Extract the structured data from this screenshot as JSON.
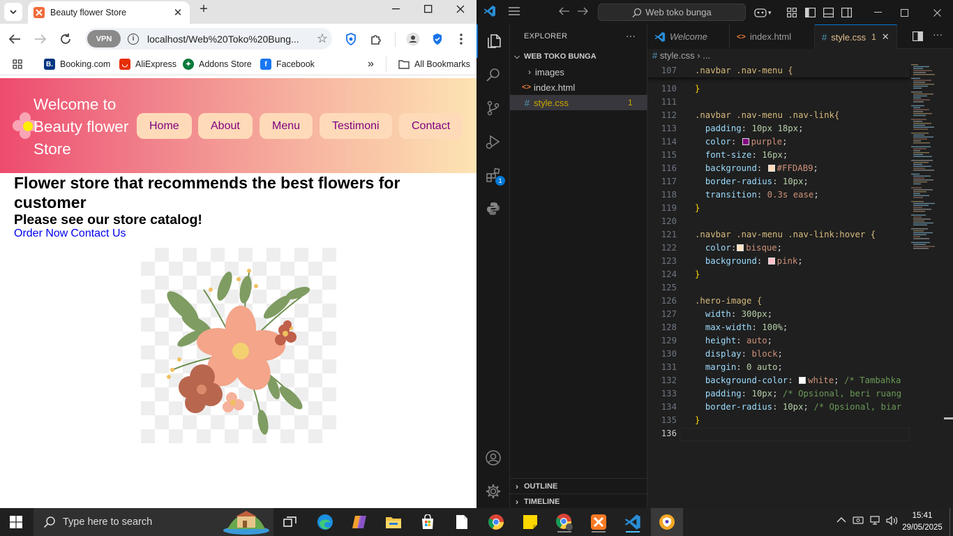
{
  "browser": {
    "tab_title": "Beauty flower Store",
    "url": "localhost/Web%20Toko%20Bung...",
    "vpn_label": "VPN",
    "bookmarks": [
      "Booking.com",
      "AliExpress",
      "Addons Store",
      "Facebook"
    ],
    "bookmarks_overflow": "»",
    "all_bookmarks": "All Bookmarks"
  },
  "page": {
    "brand": "Welcome to Beauty flower Store",
    "nav": [
      "Home",
      "About",
      "Menu",
      "Testimoni",
      "Contact"
    ],
    "heading": "Flower store that recommends the best flowers for customer",
    "subheading": "Please see our store catalog!",
    "link_order": "Order Now",
    "link_contact": "Contact Us"
  },
  "vscode": {
    "search": "Web toko bunga",
    "explorer_title": "EXPLORER",
    "project": "WEB TOKO BUNGA",
    "tree": [
      {
        "name": "images",
        "type": "folder"
      },
      {
        "name": "index.html",
        "type": "html"
      },
      {
        "name": "style.css",
        "type": "css",
        "problems": "1"
      }
    ],
    "sections": [
      "OUTLINE",
      "TIMELINE"
    ],
    "tabs": [
      "Welcome",
      "index.html",
      "style.css"
    ],
    "active_tab_problems": "1",
    "breadcrumb": "style.css  ›  ...",
    "extensions_badge": "1",
    "sticky_line": "107",
    "sticky_code": ".navbar .nav-menu {",
    "line_numbers": [
      "110",
      "111",
      "112",
      "113",
      "114",
      "115",
      "116",
      "117",
      "118",
      "119",
      "120",
      "121",
      "122",
      "123",
      "124",
      "125",
      "126",
      "127",
      "128",
      "129",
      "130",
      "131",
      "132",
      "133",
      "134",
      "135",
      "136"
    ],
    "code": {
      "l112": ".navbar .nav-menu .nav-link{",
      "l113_p": "padding",
      "l113_v": "10px 18px",
      "l114_p": "color",
      "l114_v": "purple",
      "l115_p": "font-size",
      "l115_v": "16px",
      "l116_p": "background",
      "l116_v": "#FFDAB9",
      "l117_p": "border-radius",
      "l117_v": "10px",
      "l118_p": "transition",
      "l118_v": "0.3s ease",
      "l121": ".navbar .nav-menu .nav-link:hover {",
      "l122_p": "color",
      "l122_v": "bisque",
      "l123_p": "background",
      "l123_v": "pink",
      "l126": ".hero-image {",
      "l127_p": "width",
      "l127_v": "300px",
      "l128_p": "max-width",
      "l128_v": "100%",
      "l129_p": "height",
      "l129_v": "auto",
      "l130_p": "display",
      "l130_v": "block",
      "l131_p": "margin",
      "l131_v": "0 auto",
      "l132_p": "background-color",
      "l132_v": "white",
      "l132_c": "/* Tambahka",
      "l133_p": "padding",
      "l133_v": "10px",
      "l133_c": "/* Opsional, beri ruang",
      "l134_p": "border-radius",
      "l134_v": "10px",
      "l134_c": "/* Opsional, biar"
    },
    "swatches": {
      "purple": "#800080",
      "peach": "#FFDAB9",
      "bisque": "#FFE4C4",
      "pink": "#FFC0CB",
      "white": "#FFFFFF"
    }
  },
  "taskbar": {
    "search_placeholder": "Type here to search",
    "time": "15:41",
    "date": "29/05/2025"
  },
  "colors": {
    "accent": "#0078d4",
    "nav_link_bg": "#FFDAB9",
    "nav_link_text": "#800080"
  }
}
